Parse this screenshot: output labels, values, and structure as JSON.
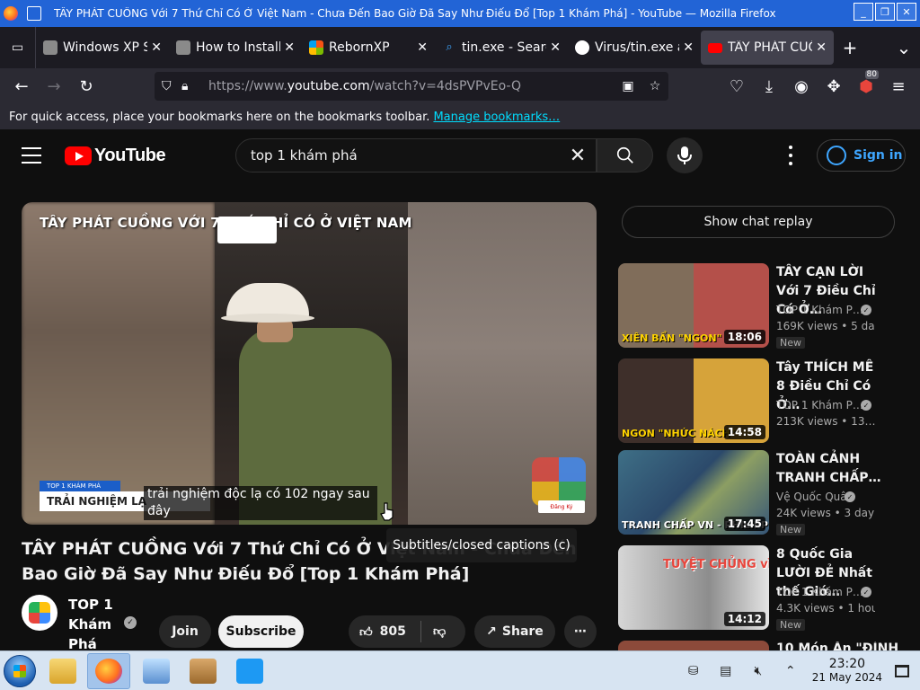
{
  "window": {
    "title": "TÂY PHÁT CUỒNG Với 7 Thứ Chỉ Có Ở Việt Nam - Chưa Đến Bao Giờ Đã Say Như Điếu Đổ [Top 1 Khám Phá] - YouTube — Mozilla Firefox"
  },
  "tabs": [
    {
      "label": "Windows XP Subs",
      "icon": "square-favicon",
      "color": "#8a8a8a"
    },
    {
      "label": "How to Install Re",
      "icon": "square-favicon",
      "color": "#8a8a8a"
    },
    {
      "label": "RebornXP",
      "icon": "windows-flag-icon",
      "color": "#f65314"
    },
    {
      "label": "tin.exe - Search",
      "icon": "search-favicon",
      "color": "#3ea6ff"
    },
    {
      "label": "Virus/tin.exe at",
      "icon": "github-icon",
      "color": "#ffffff"
    },
    {
      "label": "TÂY PHÁT CUỒNG",
      "icon": "youtube-icon",
      "color": "#ff0000",
      "active": true
    }
  ],
  "nav": {
    "url_prefix": "https://www.",
    "url_domain": "youtube.com",
    "url_path": "/watch?v=4dsPVPvEo-Q",
    "extensions_badge": "80"
  },
  "bookmarks": {
    "message": "For quick access, place your bookmarks here on the bookmarks toolbar.",
    "link": "Manage bookmarks…"
  },
  "youtube": {
    "logo_text": "YouTube",
    "search_query": "top 1 khám phá",
    "sign_in": "Sign in"
  },
  "player": {
    "overlay_title": "TÂY PHÁT CUỒNG VỚI 7 THỨ CHỈ CÓ Ở VIỆT NAM",
    "lower_third_top": "TOP 1 KHÁM PHÁ",
    "lower_third_main": "TRẢI NGHIỆM LẠ",
    "caption": "trải nghiệm độc lạ có 102 ngay sau đây",
    "subscribe_badge": "Đăng Ký",
    "tooltip": "Subtitles/closed captions (c)"
  },
  "video": {
    "title": "TÂY PHÁT CUỒNG Với 7 Thứ Chỉ Có Ở Việt Nam - Chưa Đến Bao Giờ Đã Say Như Điếu Đổ [Top 1 Khám Phá]",
    "channel": "TOP 1 Khám Phá",
    "join": "Join",
    "subscribe": "Subscribe",
    "likes": "805",
    "share": "Share"
  },
  "sidebar": {
    "chat_replay": "Show chat replay",
    "recommendations": [
      {
        "title": "TÂY CẠN LỜI Với 7 Điều Chỉ Có Ở…",
        "channel": "TOP 1 Khám P…",
        "meta": "169K views • 5 da…",
        "duration": "18:06",
        "badge": "New",
        "thumb_text": "XIÊN BẨN \"NGON\""
      },
      {
        "title": "Tây THÍCH MÊ 8 Điều Chỉ Có Ở…",
        "channel": "TOP 1 Khám P…",
        "meta": "213K views • 13…",
        "duration": "14:58",
        "badge": "",
        "thumb_text": "NGON \"NHỨC NÁCH\""
      },
      {
        "title": "TOÀN CẢNH TRANH CHẤP…",
        "channel": "Vệ Quốc Quân",
        "meta": "24K views • 3 day…",
        "duration": "17:45",
        "badge": "New",
        "thumb_text": "TRANH CHẤP VN - PHILIPPINES"
      },
      {
        "title": "8 Quốc Gia LƯỜI ĐẺ Nhất thế Giớ…",
        "channel": "TOP 1 Khám P…",
        "meta": "4.3K views • 1 hou…",
        "duration": "14:12",
        "badge": "New",
        "thumb_text": "TUYỆT CHỦNG vì…. SỢ ĐẺ"
      }
    ],
    "partial_title": "10 Món Ăn \"ĐỈNH"
  },
  "taskbar": {
    "time": "23:20",
    "date": "21 May 2024"
  }
}
